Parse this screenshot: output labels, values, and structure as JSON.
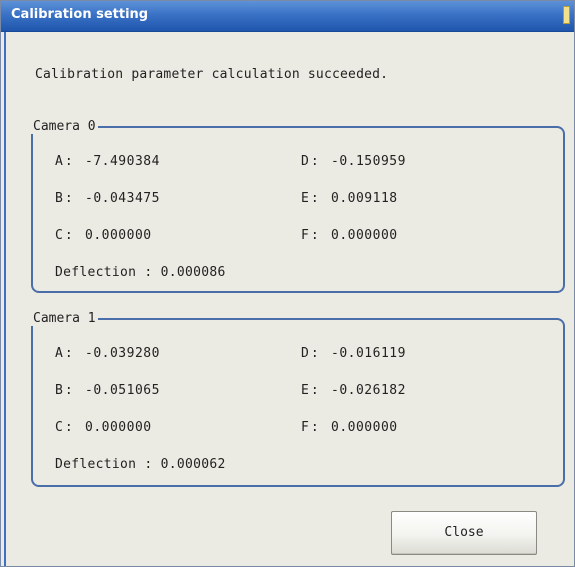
{
  "window": {
    "title": "Calibration setting"
  },
  "message": "Calibration parameter calculation succeeded.",
  "cameras": [
    {
      "name": "Camera 0",
      "params": {
        "A": "-7.490384",
        "B": "-0.043475",
        "C": "0.000000",
        "D": "-0.150959",
        "E": "0.009118",
        "F": "0.000000"
      },
      "deflection_label": "Deflection : ",
      "deflection": "0.000086"
    },
    {
      "name": "Camera 1",
      "params": {
        "A": "-0.039280",
        "B": "-0.051065",
        "C": "0.000000",
        "D": "-0.016119",
        "E": "-0.026182",
        "F": "0.000000"
      },
      "deflection_label": "Deflection : ",
      "deflection": "0.000062"
    }
  ],
  "labels": {
    "A": "A:",
    "B": "B:",
    "C": "C:",
    "D": "D:",
    "E": "E:",
    "F": "F:"
  },
  "buttons": {
    "close": "Close"
  },
  "colors": {
    "title_bar": "#3a72c6",
    "group_border": "#4a6ea9",
    "dialog_bg": "#ecebe3"
  }
}
